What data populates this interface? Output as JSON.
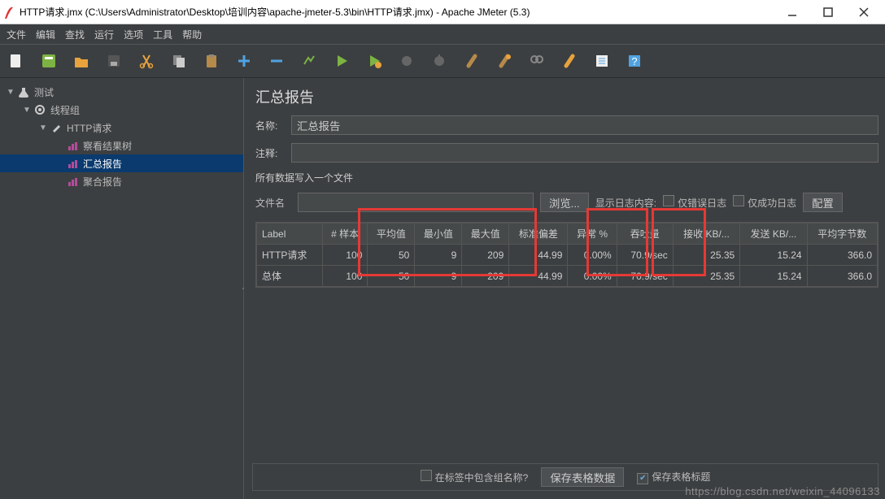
{
  "window": {
    "title": "HTTP请求.jmx (C:\\Users\\Administrator\\Desktop\\培训内容\\apache-jmeter-5.3\\bin\\HTTP请求.jmx) - Apache JMeter (5.3)"
  },
  "menu": {
    "items": [
      "文件",
      "编辑",
      "查找",
      "运行",
      "选项",
      "工具",
      "帮助"
    ]
  },
  "tree": {
    "items": [
      {
        "label": "测试",
        "icon": "flask",
        "depth": 0,
        "arrow": "▼"
      },
      {
        "label": "线程组",
        "icon": "gear",
        "depth": 1,
        "arrow": "▼"
      },
      {
        "label": "HTTP请求",
        "icon": "dropper",
        "depth": 2,
        "arrow": "▼"
      },
      {
        "label": "察看结果树",
        "icon": "chart",
        "depth": 3,
        "arrow": ""
      },
      {
        "label": "汇总报告",
        "icon": "chart",
        "depth": 3,
        "arrow": "",
        "selected": true
      },
      {
        "label": "聚合报告",
        "icon": "chart",
        "depth": 3,
        "arrow": ""
      }
    ]
  },
  "panel": {
    "title": "汇总报告",
    "name_label": "名称:",
    "name_value": "汇总报告",
    "comment_label": "注释:",
    "comment_value": "",
    "file_section": "所有数据写入一个文件",
    "filename_label": "文件名",
    "filename_value": "",
    "browse": "浏览...",
    "log_label": "显示日志内容:",
    "only_err": "仅错误日志",
    "only_ok": "仅成功日志",
    "configure": "配置"
  },
  "table": {
    "headers": [
      "Label",
      "# 样本",
      "平均值",
      "最小值",
      "最大值",
      "标准偏差",
      "异常 %",
      "吞吐量",
      "接收 KB/...",
      "发送 KB/...",
      "平均字节数"
    ],
    "rows": [
      [
        "HTTP请求",
        "100",
        "50",
        "9",
        "209",
        "44.99",
        "0.00%",
        "70.9/sec",
        "25.35",
        "15.24",
        "366.0"
      ],
      [
        "总体",
        "100",
        "50",
        "9",
        "209",
        "44.99",
        "0.00%",
        "70.9/sec",
        "25.35",
        "15.24",
        "366.0"
      ]
    ]
  },
  "footer": {
    "include_group": "在标签中包含组名称?",
    "save_data": "保存表格数据",
    "save_header": "保存表格标题"
  },
  "watermark": "https://blog.csdn.net/weixin_44096133"
}
